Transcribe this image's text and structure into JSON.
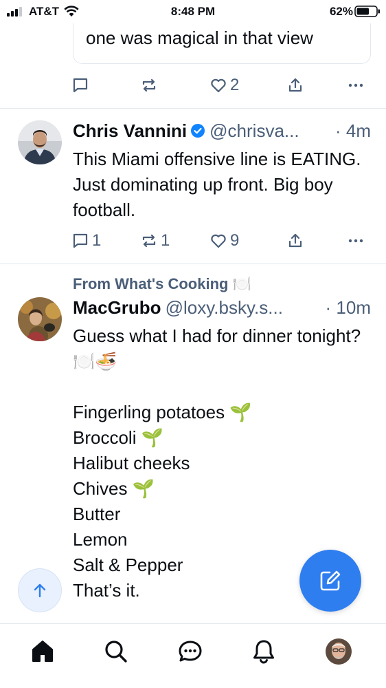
{
  "status_bar": {
    "carrier": "AT&T",
    "time": "8:48 PM",
    "battery": "62%"
  },
  "partial_post": {
    "quote_text": "one was magical in that view",
    "actions": {
      "reply_count": "",
      "repost_count": "",
      "like_count": "2"
    }
  },
  "posts": [
    {
      "author": "Chris Vannini",
      "verified": true,
      "handle": "@chrisva...",
      "time": "· 4m",
      "text": "This Miami offensive line is EATING. Just dominating up front. Big boy football.",
      "actions": {
        "reply_count": "1",
        "repost_count": "1",
        "like_count": "9"
      }
    },
    {
      "context": "From What's Cooking 🍽️",
      "author": "MacGrubo",
      "handle": "@loxy.bsky.s...",
      "time": "· 10m",
      "text": "Guess what I had for dinner tonight? 🍽️🍜\n\nFingerling potatoes 🌱\nBroccoli 🌱\nHalibut cheeks\nChives 🌱\nButter\nLemon\nSalt & Pepper\nThat’s it."
    }
  ],
  "colors": {
    "accent": "#2f7ef0",
    "muted": "#4a5e78",
    "divider": "#e3e8ee",
    "verified": "#1083fe"
  },
  "icons": {
    "reply": "speech-bubble-icon",
    "repost": "repost-icon",
    "like": "heart-icon",
    "share": "share-icon",
    "more": "ellipsis-icon",
    "tabs": [
      "home-icon",
      "search-icon",
      "chat-icon",
      "bell-icon",
      "profile-avatar"
    ]
  }
}
